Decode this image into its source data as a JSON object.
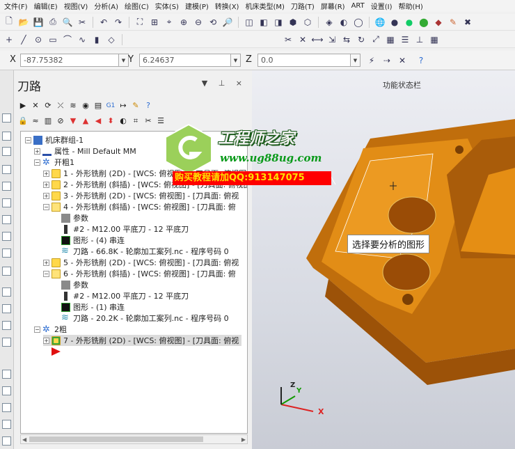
{
  "menubar": {
    "items": [
      "文件(F)",
      "编辑(E)",
      "视图(V)",
      "分析(A)",
      "绘图(C)",
      "实体(S)",
      "建模(P)",
      "转换(X)",
      "机床类型(M)",
      "刀路(T)",
      "屏幕(R)",
      "ART",
      "设置(I)",
      "帮助(H)"
    ]
  },
  "coords": {
    "x_label": "X",
    "x_value": "-87.75382",
    "y_label": "Y",
    "y_value": "6.24637",
    "z_label": "Z",
    "z_value": "0.0"
  },
  "panel": {
    "title": "刀路",
    "pin_icons": "▼ ⊥ ×"
  },
  "tree": {
    "root": "机床群组-1",
    "properties": "属性 - Mill Default MM",
    "group1": "开粗1",
    "op1": "1 - 外形铣削 (2D) - [WCS: 俯视图] - [刀具面: 俯视图]",
    "op2": "2 - 外形铣削 (斜插) - [WCS: 俯视图] - [刀具面: 俯视图]",
    "op3": "3 - 外形铣削 (2D) - [WCS: 俯视图] - [刀具面: 俯视",
    "op4": "4 - 外形铣削 (斜插) - [WCS: 俯视图] - [刀具面: 俯",
    "op4_params": "参数",
    "op4_tool": "#2 - M12.00 平底刀 - 12 平底刀",
    "op4_geom": "图形 - (4) 串连",
    "op4_path": "刀路 - 66.8K - 轮廓加工案列.nc - 程序号码 0",
    "op5": "5 - 外形铣削 (2D) - [WCS: 俯视图] - [刀具面: 俯视",
    "op6": "6 - 外形铣削 (斜插) - [WCS: 俯视图] - [刀具面: 俯",
    "op6_params": "参数",
    "op6_tool": "#2 - M12.00 平底刀 - 12 平底刀",
    "op6_geom": "图形 - (1) 串连",
    "op6_path": "刀路 - 20.2K - 轮廓加工案列.nc - 程序号码 0",
    "group2": "2粗",
    "op7": "7 - 外形铣削 (2D) - [WCS: 俯视图] - [刀具面: 俯视"
  },
  "viewport": {
    "title": "功能状态栏",
    "tooltip": "选择要分析的图形",
    "axis_x": "X",
    "axis_y": "Y",
    "axis_z": "Z"
  },
  "watermark": {
    "title": "工程师之家",
    "url": "www.ug88ug.com",
    "promo": "购买教程请加QQ:913147075"
  },
  "colors": {
    "part_orange": "#e08a12",
    "part_dark": "#8a4a06",
    "folder": "#ffd84a",
    "promo_bg": "#ff0000"
  }
}
